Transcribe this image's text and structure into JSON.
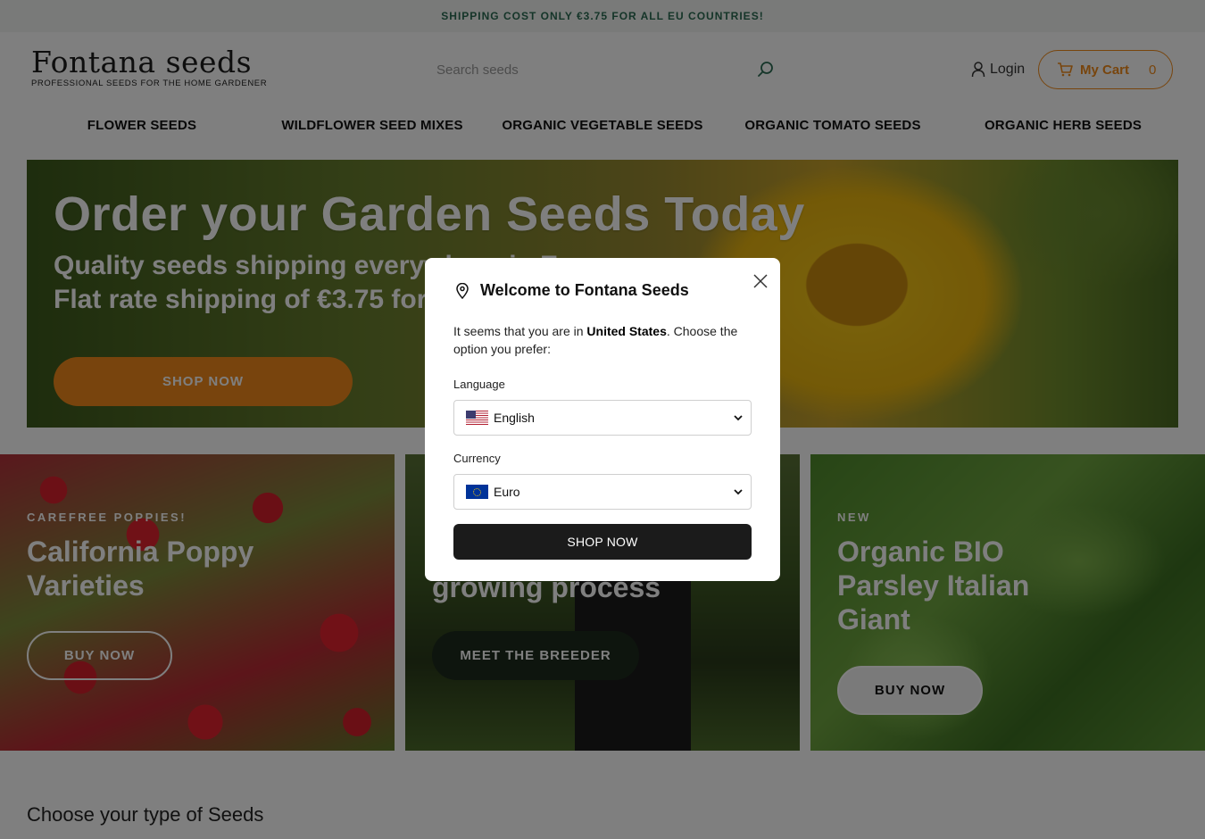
{
  "topbar": {
    "text": "SHIPPING COST ONLY €3.75 FOR ALL EU COUNTRIES!"
  },
  "header": {
    "logo_name": "Fontana seeds",
    "logo_tagline": "PROFESSIONAL SEEDS FOR THE HOME GARDENER",
    "search_placeholder": "Search seeds",
    "login_label": "Login",
    "cart_label": "My Cart",
    "cart_count": "0"
  },
  "nav": {
    "items": [
      {
        "label": "FLOWER SEEDS"
      },
      {
        "label": "WILDFLOWER SEED MIXES"
      },
      {
        "label": "ORGANIC VEGETABLE SEEDS"
      },
      {
        "label": "ORGANIC TOMATO SEEDS"
      },
      {
        "label": "ORGANIC HERB SEEDS"
      }
    ]
  },
  "hero": {
    "title": "Order your Garden Seeds Today",
    "subtitle_line1": "Quality seeds shipping everywhere in Europe",
    "subtitle_line2": "Flat rate shipping of €3.75 for EU countries",
    "button": "SHOP NOW"
  },
  "promos": [
    {
      "eyebrow": "CAREFREE POPPIES!",
      "title": "California Poppy Varieties",
      "button": "BUY NOW"
    },
    {
      "eyebrow": "",
      "title": "growing process",
      "button": "MEET THE BREEDER"
    },
    {
      "eyebrow": "NEW",
      "title": "Organic BIO Parsley Italian Giant",
      "button": "BUY NOW"
    }
  ],
  "section": {
    "title": "Choose your type of Seeds"
  },
  "modal": {
    "title": "Welcome to Fontana Seeds",
    "text_before": "It seems that you are in ",
    "country": "United States",
    "text_after": ". Choose the option you prefer:",
    "language_label": "Language",
    "language_value": "English",
    "currency_label": "Currency",
    "currency_value": "Euro",
    "button": "SHOP NOW"
  },
  "colors": {
    "accent": "#f08a1a",
    "dark": "#1b1b1b",
    "brand_green": "#2b6b52"
  },
  "icons": [
    "search-icon",
    "user-icon",
    "cart-icon",
    "location-pin-icon",
    "close-icon",
    "chevron-down-icon",
    "us-flag-icon",
    "eu-flag-icon"
  ]
}
